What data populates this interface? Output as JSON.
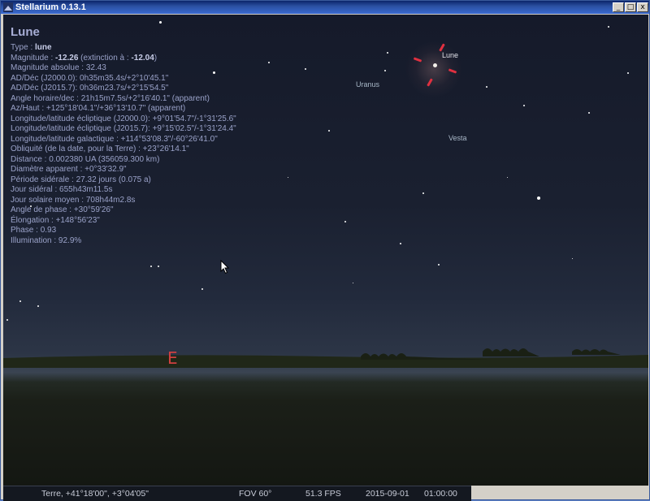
{
  "window": {
    "title": "Stellarium 0.13.1",
    "buttons": {
      "minimize": "_",
      "maximize": "□",
      "close": "x"
    }
  },
  "info": {
    "name": "Lune",
    "type_label": "Type : ",
    "type_value": "lune",
    "magnitude_label": "Magnitude : ",
    "magnitude_value": "-12.26",
    "extinction_label": " (extinction à : ",
    "extinction_value": "-12.04",
    "extinction_close": ")",
    "lines": [
      "Magnitude absolue : 32.43",
      "AD/Déc (J2000.0): 0h35m35.4s/+2°10'45.1\"",
      "AD/Déc (J2015.7): 0h36m23.7s/+2°15'54.5\"",
      "Angle horaire/dec : 21h15m7.5s/+2°16'40.1\" (apparent)",
      "Az/Haut : +125°18'04.1\"/+36°13'10.7\" (apparent)",
      "Longitude/latitude écliptique (J2000.0): +9°01'54.7\"/-1°31'25.6\"",
      "Longitude/latitude écliptique (J2015.7): +9°15'02.5\"/-1°31'24.4\"",
      "Longitude/latitude galactique : +114°53'08.3\"/-60°26'41.0\"",
      "Obliquité (de la date, pour la Terre) : +23°26'14.1\"",
      "Distance : 0.002380 UA (356059.300 km)",
      "Diamètre apparent : +0°33'32.9\"",
      "Période sidérale : 27.32 jours (0.075 a)",
      "Jour sidéral : 655h43m11.5s",
      "Jour solaire moyen : 708h44m2.8s",
      "Angle de phase : +30°59'26\"",
      "Élongation : +148°56'23\"",
      "Phase : 0.93",
      "Illumination : 92.9%"
    ]
  },
  "sky_labels": {
    "moon": "Lune",
    "uranus": "Uranus",
    "vesta": "Vesta",
    "cardinal_east": "E"
  },
  "statusbar": {
    "location": "Terre, +41°18'00\", +3°04'05\"",
    "fov": "FOV 60°",
    "fps": "51.3 FPS",
    "date": "2015-09-01",
    "time": "01:00:00"
  },
  "colors": {
    "marker": "#e03040",
    "info_text": "#9aa2c9",
    "cardinal": "#d04040"
  }
}
